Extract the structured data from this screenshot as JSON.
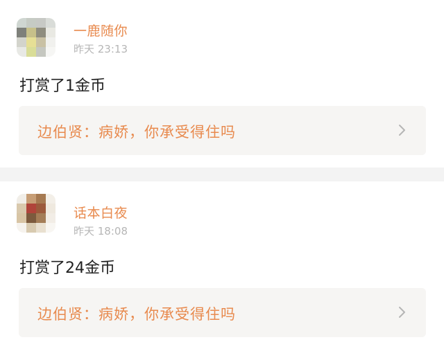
{
  "feed": {
    "items": [
      {
        "username": "一鹿随你",
        "time": "昨天 23:13",
        "message": "打赏了1金币",
        "book_title": "边伯贤：病娇，你承受得住吗",
        "avatar_icon": "user-avatar-icon",
        "chevron_icon": "chevron-right-icon"
      },
      {
        "username": "话本白夜",
        "time": "昨天 18:08",
        "message": "打赏了24金币",
        "book_title": "边伯贤：病娇，你承受得住吗",
        "avatar_icon": "user-avatar-icon",
        "chevron_icon": "chevron-right-icon"
      }
    ]
  },
  "colors": {
    "accent": "#e88a4e",
    "timestamp": "#b6b6b6",
    "text": "#222222",
    "link_background": "#f6f5f3",
    "page_background": "#f3f3f3"
  }
}
